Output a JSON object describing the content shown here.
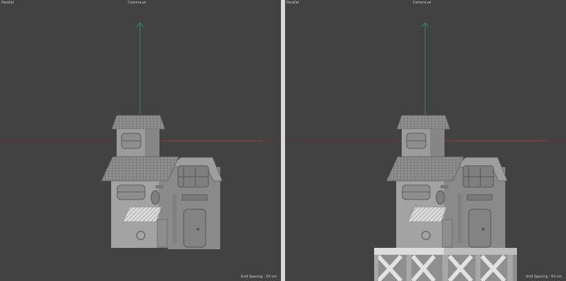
{
  "viewports": [
    {
      "projection_label": "Parallel",
      "camera_label": "Camera ▸▾",
      "grid_label": "Grid Spacing : 50 cm"
    },
    {
      "projection_label": "Parallel",
      "camera_label": "Camera ▸▾",
      "grid_label": "Grid Spacing : 50 cm"
    }
  ],
  "colors": {
    "viewport_bg": "#424242",
    "axis_x": "#8a3a3a",
    "axis_y": "#2f8a72",
    "model": "#9a9a9a"
  }
}
